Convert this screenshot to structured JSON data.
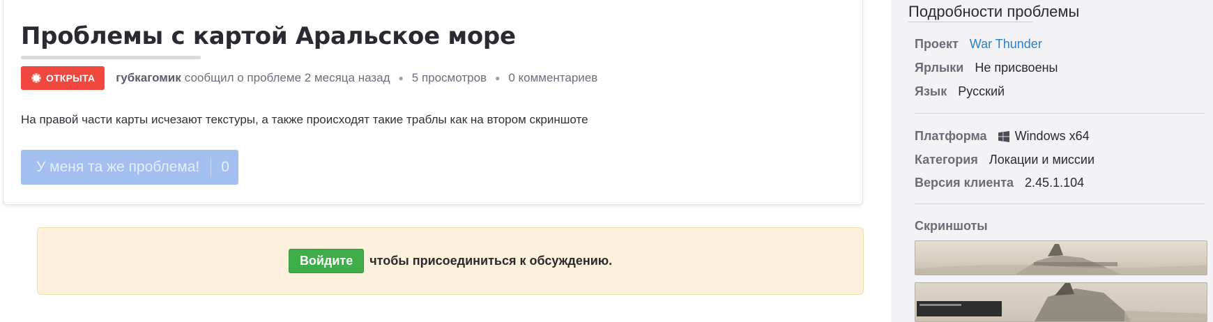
{
  "issue": {
    "title": "Проблемы с картой Аральское море",
    "status_label": "ОТКРЫТА",
    "author": "губкагомик",
    "reported_text": "сообщил о проблеме 2 месяца назад",
    "views": "5 просмотров",
    "comments": "0 комментариев",
    "description": "На правой части карты исчезают текстуры, а также происходят такие траблы как на втором скриншоте",
    "same_problem_label": "У меня та же проблема!",
    "same_problem_count": "0",
    "status_color": "#f0483e"
  },
  "login_banner": {
    "button_label": "Войдите",
    "text": "чтобы присоединиться к обсуждению."
  },
  "sidebar": {
    "title": "Подробности проблемы",
    "project_label": "Проект",
    "project_value": "War Thunder",
    "tags_label": "Ярлыки",
    "tags_value": "Не присвоены",
    "language_label": "Язык",
    "language_value": "Русский",
    "platform_label": "Платформа",
    "platform_value": "Windows x64",
    "platform_icon": "windows-icon",
    "category_label": "Категория",
    "category_value": "Локации и миссии",
    "version_label": "Версия клиента",
    "version_value": "2.45.1.104",
    "screenshots_label": "Скриншоты"
  }
}
